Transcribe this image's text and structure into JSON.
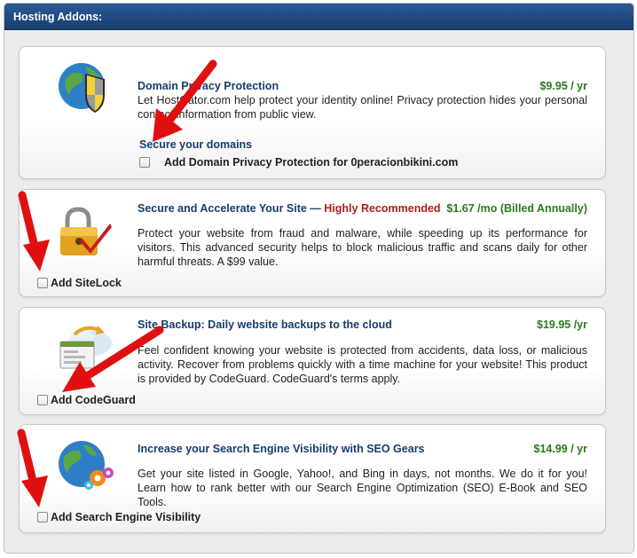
{
  "panel": {
    "title": "Hosting Addons:"
  },
  "addons": [
    {
      "title": "Domain Privacy Protection",
      "price": "$9.95 / yr",
      "description": "Let HostGator.com help protect your identity online! Privacy protection hides your personal contact information from public view.",
      "sub_heading": "Secure your domains",
      "checkbox_label": "Add Domain Privacy Protection for 0peracionbikini.com",
      "checked": false,
      "icon": "shield-globe-icon"
    },
    {
      "title": "Secure and Accelerate Your Site — ",
      "title_highlight": "Highly Recommended",
      "price": "$1.67 /mo (Billed Annually)",
      "description": "Protect your website from fraud and malware, while speeding up its performance for visitors. This advanced security helps to block malicious traffic and scans daily for other harmful threats. A $99 value.",
      "checkbox_label": "Add SiteLock",
      "checked": false,
      "icon": "padlock-checkmark-icon"
    },
    {
      "title": "Site Backup: Daily website backups to the cloud",
      "price": "$19.95 /yr",
      "description": "Feel confident knowing your website is protected from accidents, data loss, or malicious activity. Recover from problems quickly with a time machine for your website! This product is provided by CodeGuard. CodeGuard's terms apply.",
      "checkbox_label": "Add CodeGuard",
      "checked": false,
      "icon": "cloud-backup-icon"
    },
    {
      "title": "Increase your Search Engine Visibility with SEO Gears",
      "price": "$14.99 / yr",
      "description": "Get your site listed in Google, Yahoo!, and Bing in days, not months. We do it for you! Learn how to rank better with our Search Engine Optimization (SEO) E-Book and SEO Tools.",
      "checkbox_label": "Add Search Engine Visibility",
      "checked": false,
      "icon": "globe-gears-icon"
    }
  ],
  "colors": {
    "header_bg": "#1f4a80",
    "title": "#163d6c",
    "price": "#2c7a1c",
    "highlight": "#b01e1e",
    "annotation_arrow": "#e01010"
  }
}
